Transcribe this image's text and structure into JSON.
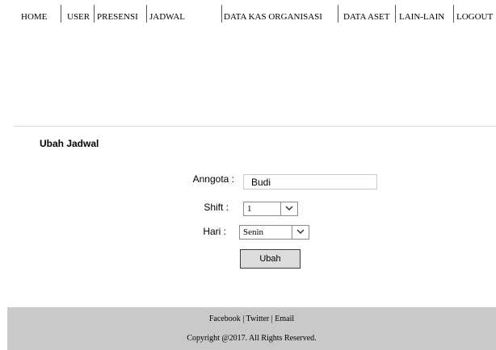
{
  "nav": {
    "items": [
      {
        "label": "HOME"
      },
      {
        "label": "USER"
      },
      {
        "label": "PRESENSI"
      },
      {
        "label": "JADWAL"
      },
      {
        "label": "DATA KAS ORGANISASI"
      },
      {
        "label": "DATA ASET"
      },
      {
        "label": "LAIN-LAIN"
      },
      {
        "label": "LOGOUT"
      }
    ]
  },
  "form": {
    "title": "Ubah Jadwal",
    "anggota_label": "Anngota :",
    "anggota_value": "Budi",
    "shift_label": "Shift :",
    "shift_value": "1",
    "hari_label": "Hari :",
    "hari_value": "Senin",
    "submit_label": "Ubah"
  },
  "footer": {
    "facebook": "Facebook",
    "twitter": "Twitter",
    "email": "Email",
    "separator": " | ",
    "copyright": "Copyright @2017. All Rights Reserved."
  }
}
